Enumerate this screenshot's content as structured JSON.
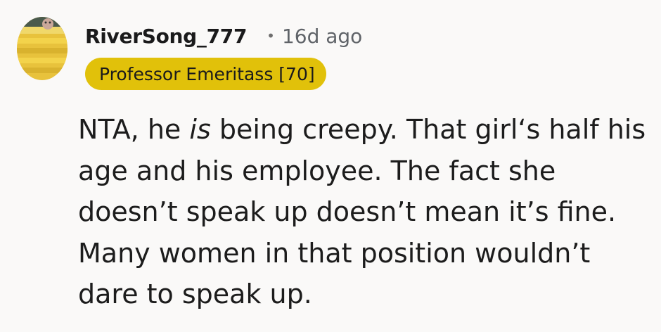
{
  "comment": {
    "username": "RiverSong_777",
    "separator": "•",
    "timestamp": "16d ago",
    "flair": "Professor Emeritass [70]",
    "body_before": "NTA, he ",
    "body_emphasis": "is",
    "body_after": " being creepy. That girl‘s half his age and his employee. The fact she doesn’t speak up doesn’t mean it’s fine. Many women in that position wouldn’t dare to speak up.",
    "colors": {
      "background": "#faf9f8",
      "flair_background": "#e1c10a",
      "text": "#1c1c1c",
      "muted": "#5f6368"
    }
  }
}
